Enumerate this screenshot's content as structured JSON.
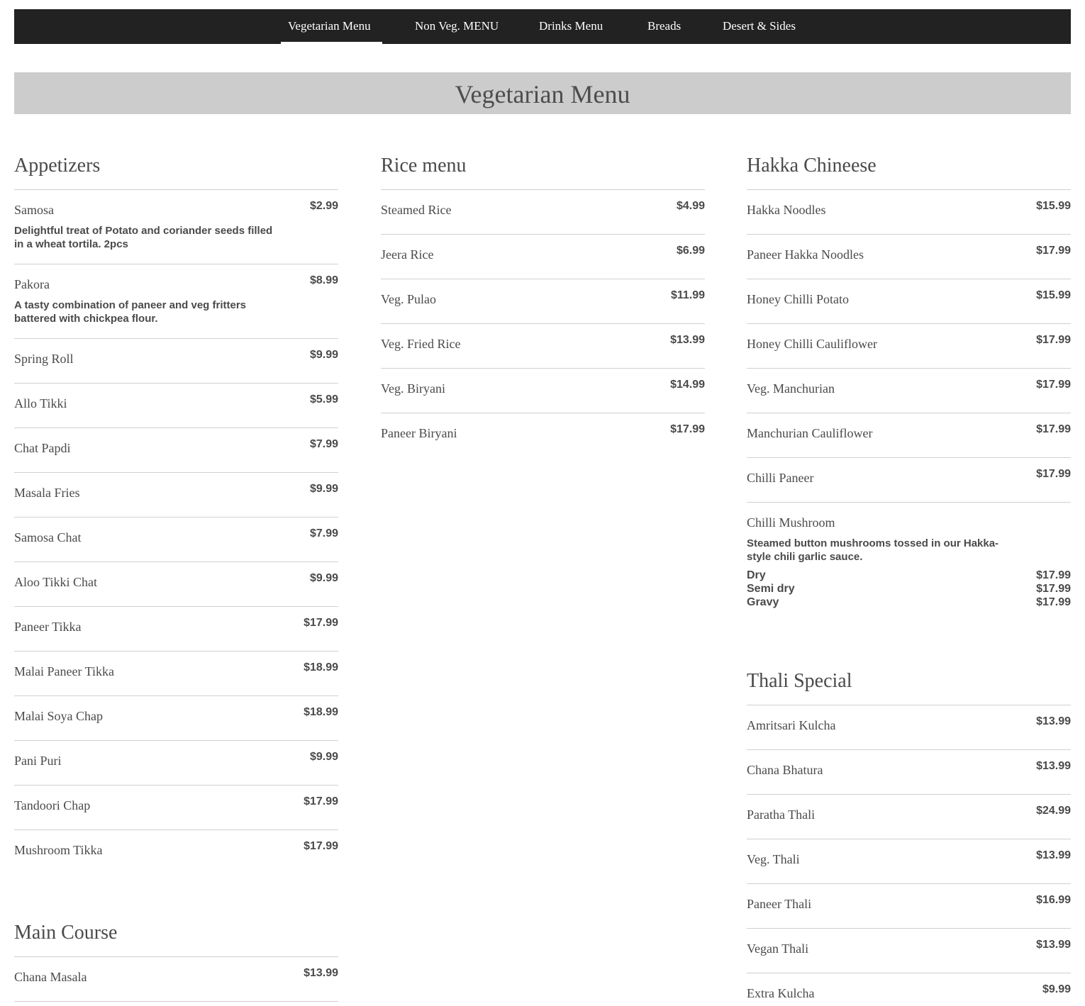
{
  "nav": {
    "tabs": [
      {
        "label": "Vegetarian Menu",
        "active": true
      },
      {
        "label": "Non Veg. MENU",
        "active": false
      },
      {
        "label": "Drinks Menu",
        "active": false
      },
      {
        "label": "Breads",
        "active": false
      },
      {
        "label": "Desert & Sides",
        "active": false
      }
    ]
  },
  "banner": {
    "title": "Vegetarian Menu"
  },
  "appetizers": {
    "title": "Appetizers",
    "items": [
      {
        "name": "Samosa",
        "price": "$2.99",
        "desc": "Delightful treat of Potato and coriander seeds filled in a wheat tortila. 2pcs"
      },
      {
        "name": "Pakora",
        "price": "$8.99",
        "desc": "A tasty combination of paneer and veg fritters battered with chickpea flour."
      },
      {
        "name": "Spring Roll",
        "price": "$9.99"
      },
      {
        "name": "Allo Tikki",
        "price": "$5.99"
      },
      {
        "name": "Chat Papdi",
        "price": "$7.99"
      },
      {
        "name": "Masala Fries",
        "price": "$9.99"
      },
      {
        "name": "Samosa Chat",
        "price": "$7.99"
      },
      {
        "name": "Aloo Tikki Chat",
        "price": "$9.99"
      },
      {
        "name": "Paneer Tikka",
        "price": "$17.99"
      },
      {
        "name": "Malai Paneer Tikka",
        "price": "$18.99"
      },
      {
        "name": "Malai Soya Chap",
        "price": "$18.99"
      },
      {
        "name": "Pani Puri",
        "price": "$9.99"
      },
      {
        "name": "Tandoori Chap",
        "price": "$17.99"
      },
      {
        "name": "Mushroom Tikka",
        "price": "$17.99"
      }
    ]
  },
  "main_course": {
    "title": "Main Course",
    "items": [
      {
        "name": "Chana Masala",
        "price": "$13.99"
      }
    ]
  },
  "rice": {
    "title": "Rice menu",
    "items": [
      {
        "name": "Steamed Rice",
        "price": "$4.99"
      },
      {
        "name": "Jeera Rice",
        "price": "$6.99"
      },
      {
        "name": "Veg. Pulao",
        "price": "$11.99"
      },
      {
        "name": "Veg. Fried Rice",
        "price": "$13.99"
      },
      {
        "name": "Veg. Biryani",
        "price": "$14.99"
      },
      {
        "name": "Paneer Biryani",
        "price": "$17.99"
      }
    ]
  },
  "hakka": {
    "title": "Hakka Chineese",
    "items": [
      {
        "name": "Hakka Noodles",
        "price": "$15.99"
      },
      {
        "name": "Paneer Hakka Noodles",
        "price": "$17.99"
      },
      {
        "name": "Honey Chilli Potato",
        "price": "$15.99"
      },
      {
        "name": "Honey Chilli Cauliflower",
        "price": "$17.99"
      },
      {
        "name": "Veg. Manchurian",
        "price": "$17.99"
      },
      {
        "name": "Manchurian Cauliflower",
        "price": "$17.99"
      },
      {
        "name": "Chilli Paneer",
        "price": "$17.99"
      }
    ],
    "special": {
      "name": "Chilli Mushroom",
      "desc": "Steamed button mushrooms tossed in our Hakka-style chili garlic sauce.",
      "variants": [
        {
          "label": "Dry",
          "price": "$17.99"
        },
        {
          "label": "Semi dry",
          "price": "$17.99"
        },
        {
          "label": "Gravy",
          "price": "$17.99"
        }
      ]
    }
  },
  "thali": {
    "title": "Thali Special",
    "items": [
      {
        "name": "Amritsari Kulcha",
        "price": "$13.99"
      },
      {
        "name": "Chana Bhatura",
        "price": "$13.99"
      },
      {
        "name": "Paratha Thali",
        "price": "$24.99"
      },
      {
        "name": "Veg. Thali",
        "price": "$13.99"
      },
      {
        "name": "Paneer Thali",
        "price": "$16.99"
      },
      {
        "name": "Vegan Thali",
        "price": "$13.99"
      },
      {
        "name": "Extra Kulcha",
        "price": "$9.99"
      }
    ]
  }
}
